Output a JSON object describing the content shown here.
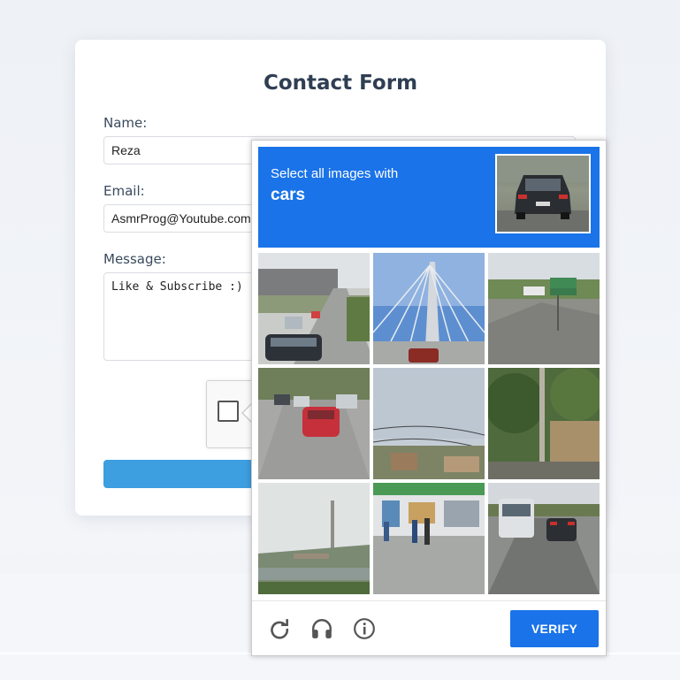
{
  "form": {
    "title": "Contact Form",
    "name_label": "Name:",
    "name_value": "Reza",
    "email_label": "Email:",
    "email_value": "AsmrProg@Youtube.com",
    "message_label": "Message:",
    "message_value": "Like & Subscribe :)"
  },
  "captcha": {
    "instruction": "Select all images with",
    "target": "cars",
    "verify_label": "VERIFY",
    "footer_icons": [
      "reload-icon",
      "audio-icon",
      "info-icon"
    ],
    "accent": "#1a73e8"
  }
}
